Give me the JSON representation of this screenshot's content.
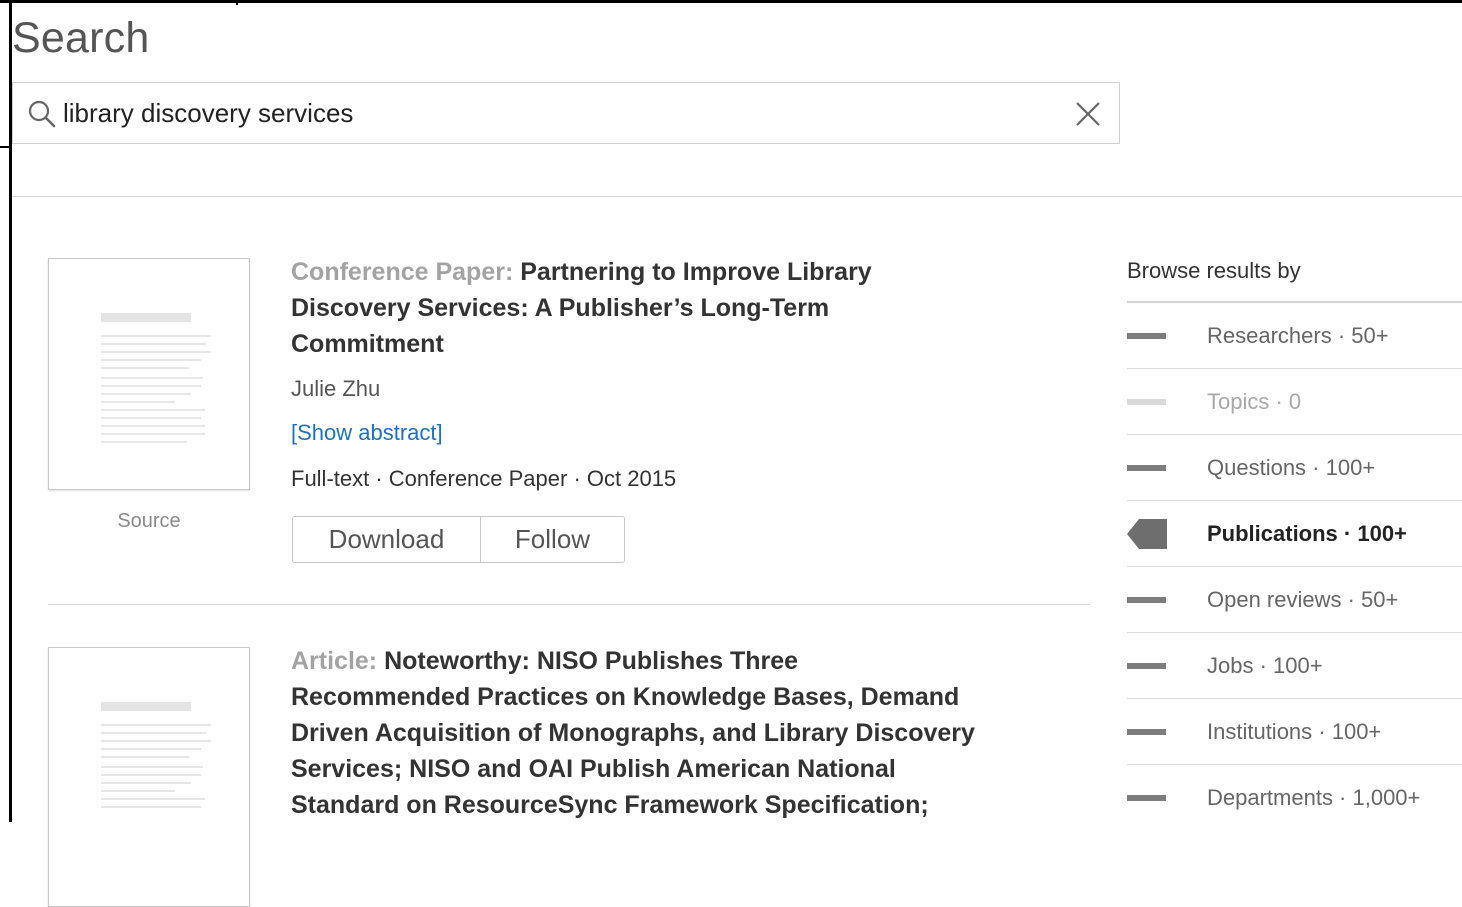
{
  "page": {
    "title": "Search"
  },
  "search": {
    "query": "library discovery services",
    "search_icon": "magnifier-icon",
    "clear_icon": "close-icon"
  },
  "results": [
    {
      "type_label": "Conference Paper:",
      "title_lines": [
        "Partnering to Improve Library",
        "Discovery Services: A Publisher’s Long-Term",
        "Commitment"
      ],
      "author": "Julie Zhu",
      "abstract_link": "[Show abstract]",
      "meta": "Full-text · Conference Paper · Oct 2015",
      "source_label": "Source",
      "download_label": "Download",
      "follow_label": "Follow"
    },
    {
      "type_label": "Article:",
      "title_lines": [
        "Noteworthy: NISO Publishes Three",
        "Recommended Practices on Knowledge Bases, Demand",
        "Driven Acquisition of Monographs, and Library Discovery",
        "Services; NISO and OAI Publish American National",
        "Standard on ResourceSync Framework Specification;"
      ]
    }
  ],
  "browse": {
    "title": "Browse results by",
    "items": [
      {
        "label": "Researchers · 50+",
        "state": "normal"
      },
      {
        "label": "Topics · 0",
        "state": "disabled"
      },
      {
        "label": "Questions · 100+",
        "state": "normal"
      },
      {
        "label": "Publications · 100+",
        "state": "active"
      },
      {
        "label": "Open reviews · 50+",
        "state": "normal"
      },
      {
        "label": "Jobs · 100+",
        "state": "normal"
      },
      {
        "label": "Institutions · 100+",
        "state": "normal"
      },
      {
        "label": "Departments · 1,000+",
        "state": "normal"
      }
    ]
  },
  "colors": {
    "link": "#1a73c9",
    "type_label": "#a3a3a3",
    "active_flag": "#6e6e6e"
  }
}
